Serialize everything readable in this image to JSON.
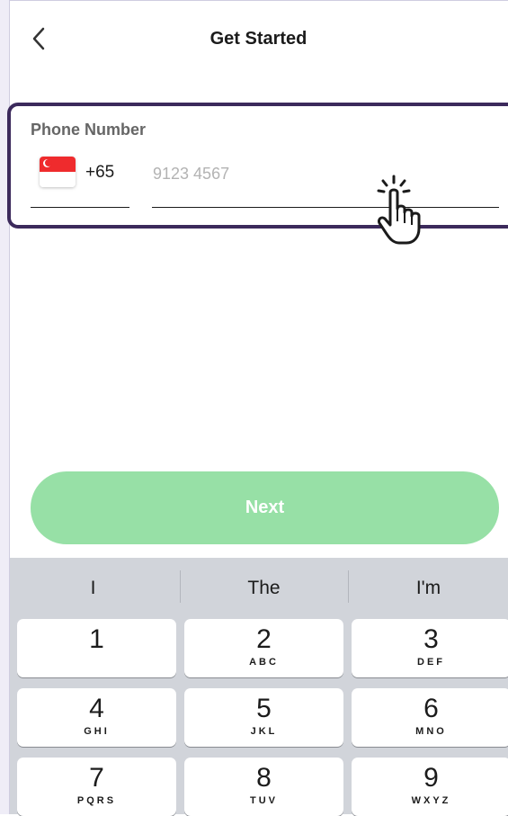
{
  "header": {
    "title": "Get Started",
    "back_icon": "chevron-left-icon"
  },
  "phone_form": {
    "label": "Phone Number",
    "country_flag": "singapore-flag-icon",
    "country_code": "+65",
    "phone_placeholder": "9123 4567",
    "phone_value": ""
  },
  "pointer": {
    "icon": "tap-hand-cursor-icon"
  },
  "next_button": {
    "label": "Next",
    "color": "#97e0a6"
  },
  "keyboard": {
    "suggestions": [
      "I",
      "The",
      "I'm"
    ],
    "keys": [
      {
        "digit": "1",
        "letters": ""
      },
      {
        "digit": "2",
        "letters": "ABC"
      },
      {
        "digit": "3",
        "letters": "DEF"
      },
      {
        "digit": "4",
        "letters": "GHI"
      },
      {
        "digit": "5",
        "letters": "JKL"
      },
      {
        "digit": "6",
        "letters": "MNO"
      },
      {
        "digit": "7",
        "letters": "PQRS"
      },
      {
        "digit": "8",
        "letters": "TUV"
      },
      {
        "digit": "9",
        "letters": "WXYZ"
      }
    ]
  },
  "colors": {
    "highlight_border": "#3c2a5c",
    "keyboard_bg": "#d1d4da",
    "flag_red": "#ef2b2d"
  }
}
